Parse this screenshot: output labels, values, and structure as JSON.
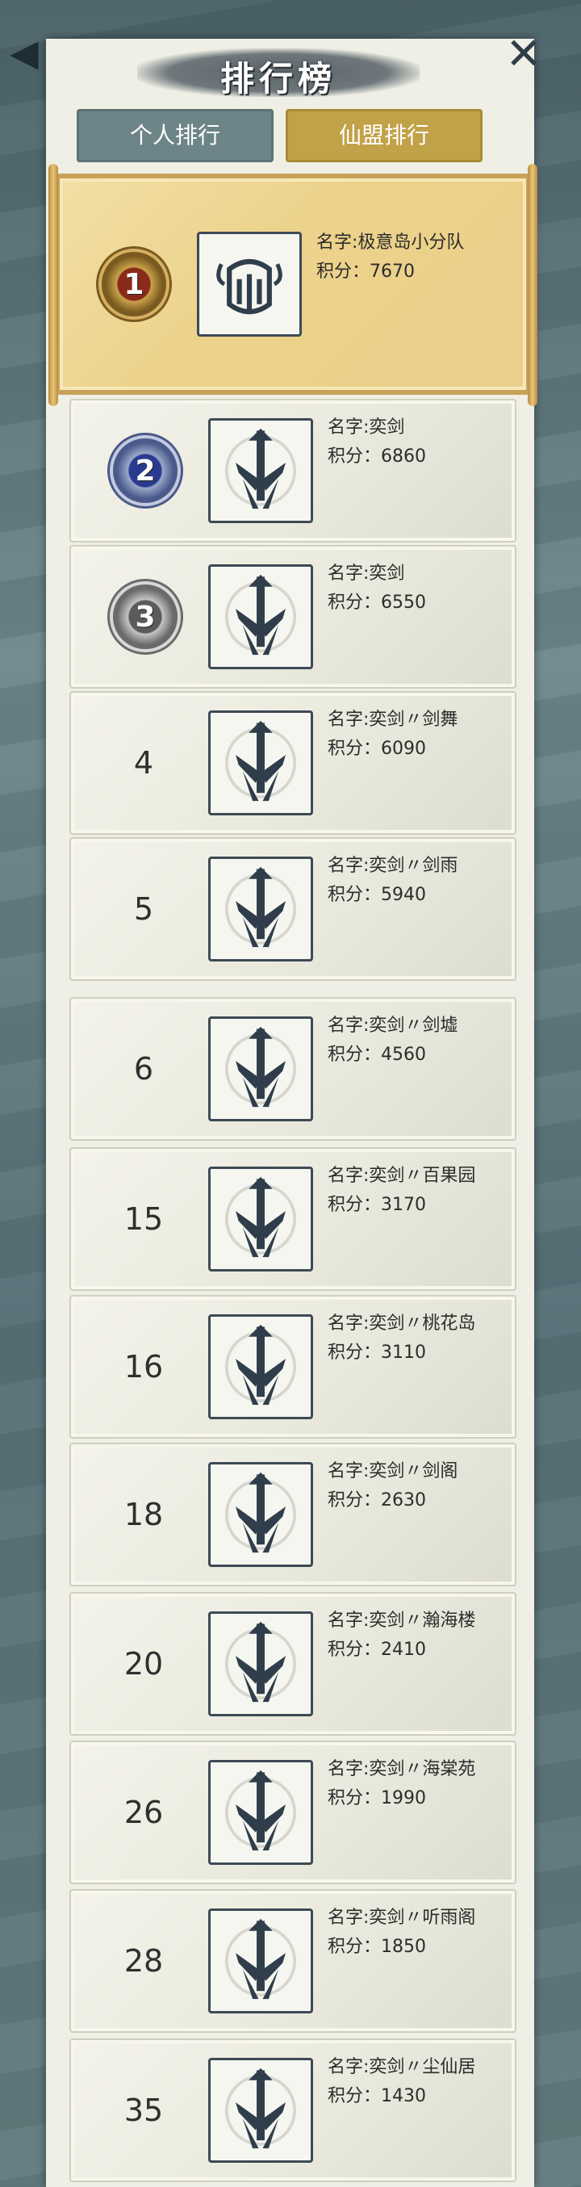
{
  "header": {
    "title": "排行榜",
    "back_icon": "back-arrow-icon",
    "close_icon": "close-icon"
  },
  "tabs": [
    {
      "label": "个人排行",
      "active": false
    },
    {
      "label": "仙盟排行",
      "active": true
    }
  ],
  "colors": {
    "tab_inactive": "#6d8588",
    "tab_active": "#c2a248",
    "first_row": "#ecd28a"
  },
  "rows": [
    {
      "rank": "1",
      "medal": "gold",
      "emblem": "crown-emblem-icon",
      "name": "名字:极意岛小分队",
      "score": "积分：7670"
    },
    {
      "rank": "2",
      "medal": "silver",
      "emblem": "sword-emblem-icon",
      "name": "名字:奕剑",
      "score": "积分：6860"
    },
    {
      "rank": "3",
      "medal": "bronze",
      "emblem": "sword-emblem-icon",
      "name": "名字:奕剑",
      "score": "积分：6550"
    },
    {
      "rank": "4",
      "emblem": "sword-emblem-icon",
      "name": "名字:奕剑〃剑舞",
      "score": "积分：6090"
    },
    {
      "rank": "5",
      "emblem": "sword-emblem-icon",
      "name": "名字:奕剑〃剑雨",
      "score": "积分：5940"
    },
    {
      "rank": "6",
      "emblem": "sword-emblem-icon",
      "name": "名字:奕剑〃剑墟",
      "score": "积分：4560"
    },
    {
      "rank": "15",
      "emblem": "sword-emblem-icon",
      "name": "名字:奕剑〃百果园",
      "score": "积分：3170"
    },
    {
      "rank": "16",
      "emblem": "sword-emblem-icon",
      "name": "名字:奕剑〃桃花岛",
      "score": "积分：3110"
    },
    {
      "rank": "18",
      "emblem": "sword-emblem-icon",
      "name": "名字:奕剑〃剑阁",
      "score": "积分：2630"
    },
    {
      "rank": "20",
      "emblem": "sword-emblem-icon",
      "name": "名字:奕剑〃瀚海楼",
      "score": "积分：2410"
    },
    {
      "rank": "26",
      "emblem": "sword-emblem-icon",
      "name": "名字:奕剑〃海棠苑",
      "score": "积分：1990"
    },
    {
      "rank": "28",
      "emblem": "sword-emblem-icon",
      "name": "名字:奕剑〃听雨阁",
      "score": "积分：1850"
    },
    {
      "rank": "35",
      "emblem": "sword-emblem-icon",
      "name": "名字:奕剑〃尘仙居",
      "score": "积分：1430"
    }
  ]
}
